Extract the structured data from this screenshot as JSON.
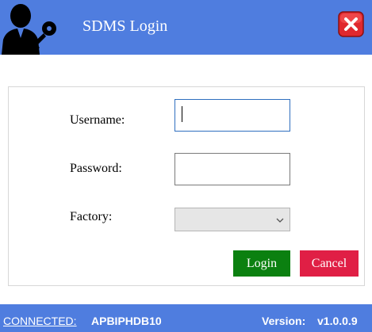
{
  "window": {
    "title": "SDMS Login",
    "icons": {
      "logo": "user-key-icon",
      "close": "close-icon"
    },
    "colors": {
      "title_bar": "#4f7ddf",
      "close_button": "#e0282e"
    }
  },
  "form": {
    "username": {
      "label": "Username:",
      "value": ""
    },
    "password": {
      "label": "Password:",
      "value": ""
    },
    "factory": {
      "label": "Factory:",
      "selected": ""
    }
  },
  "buttons": {
    "login": "Login",
    "cancel": "Cancel",
    "colors": {
      "login": "#0b8010",
      "cancel": "#e01f45"
    }
  },
  "status": {
    "connection_label": "CONNECTED:",
    "server": "APBIPHDB10",
    "version_label": "Version:",
    "version": "v1.0.0.9"
  }
}
